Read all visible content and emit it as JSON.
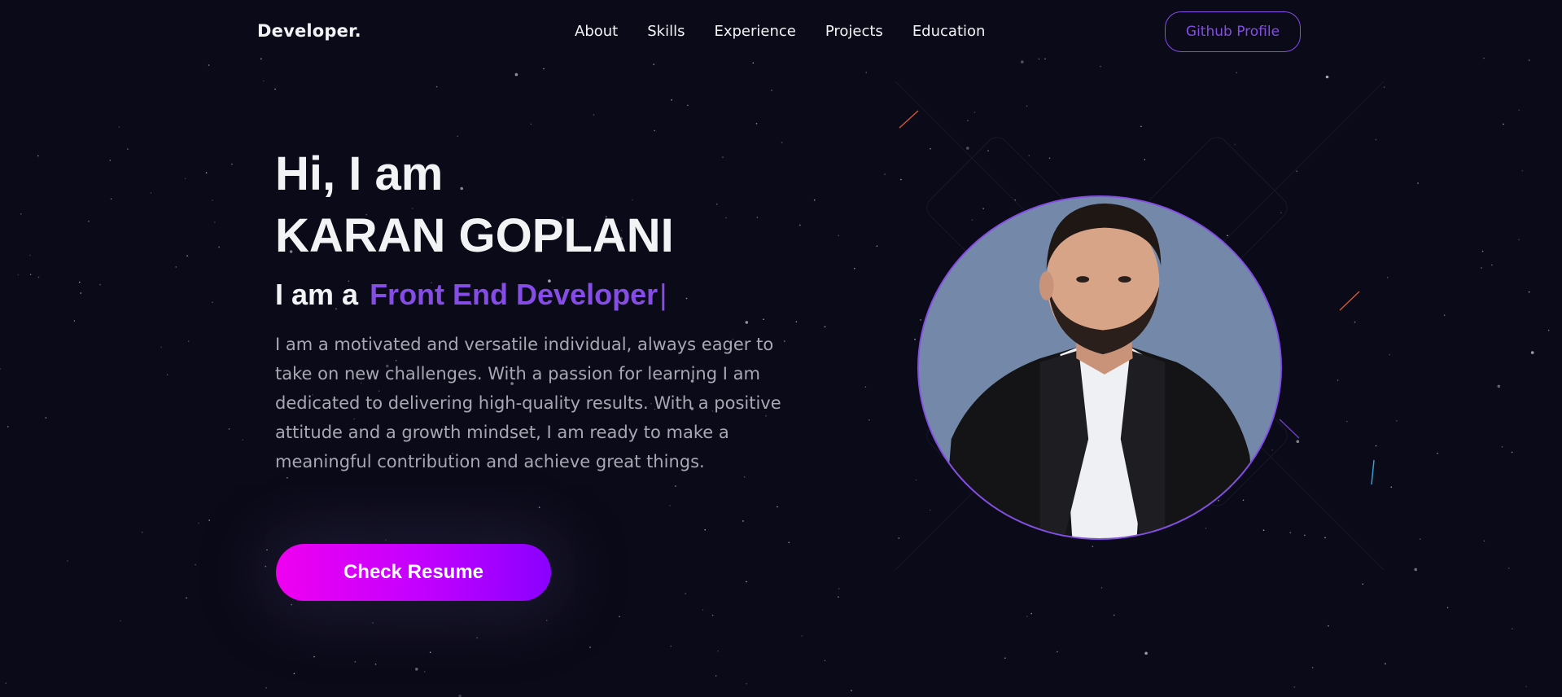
{
  "nav": {
    "logo": "Developer.",
    "links": [
      "About",
      "Skills",
      "Experience",
      "Projects",
      "Education"
    ],
    "github_label": "Github Profile"
  },
  "hero": {
    "greeting": "Hi, I am",
    "name": "KARAN GOPLANI",
    "role_prefix": "I am a",
    "role": "Front End Developer",
    "cursor": "|",
    "description": "I am a motivated and versatile individual, always eager to take on new challenges. With a passion for learning I am dedicated to delivering high-quality results. With a positive attitude and a growth mindset, I am ready to make a meaningful contribution and achieve great things.",
    "resume_label": "Check Resume"
  },
  "colors": {
    "background": "#0b0a18",
    "accent": "#854ce6",
    "text": "#f2f3f5",
    "muted_text": "#a7a8b3",
    "button_gradient_start": "#f000f0",
    "button_gradient_end": "#8a00ff"
  }
}
